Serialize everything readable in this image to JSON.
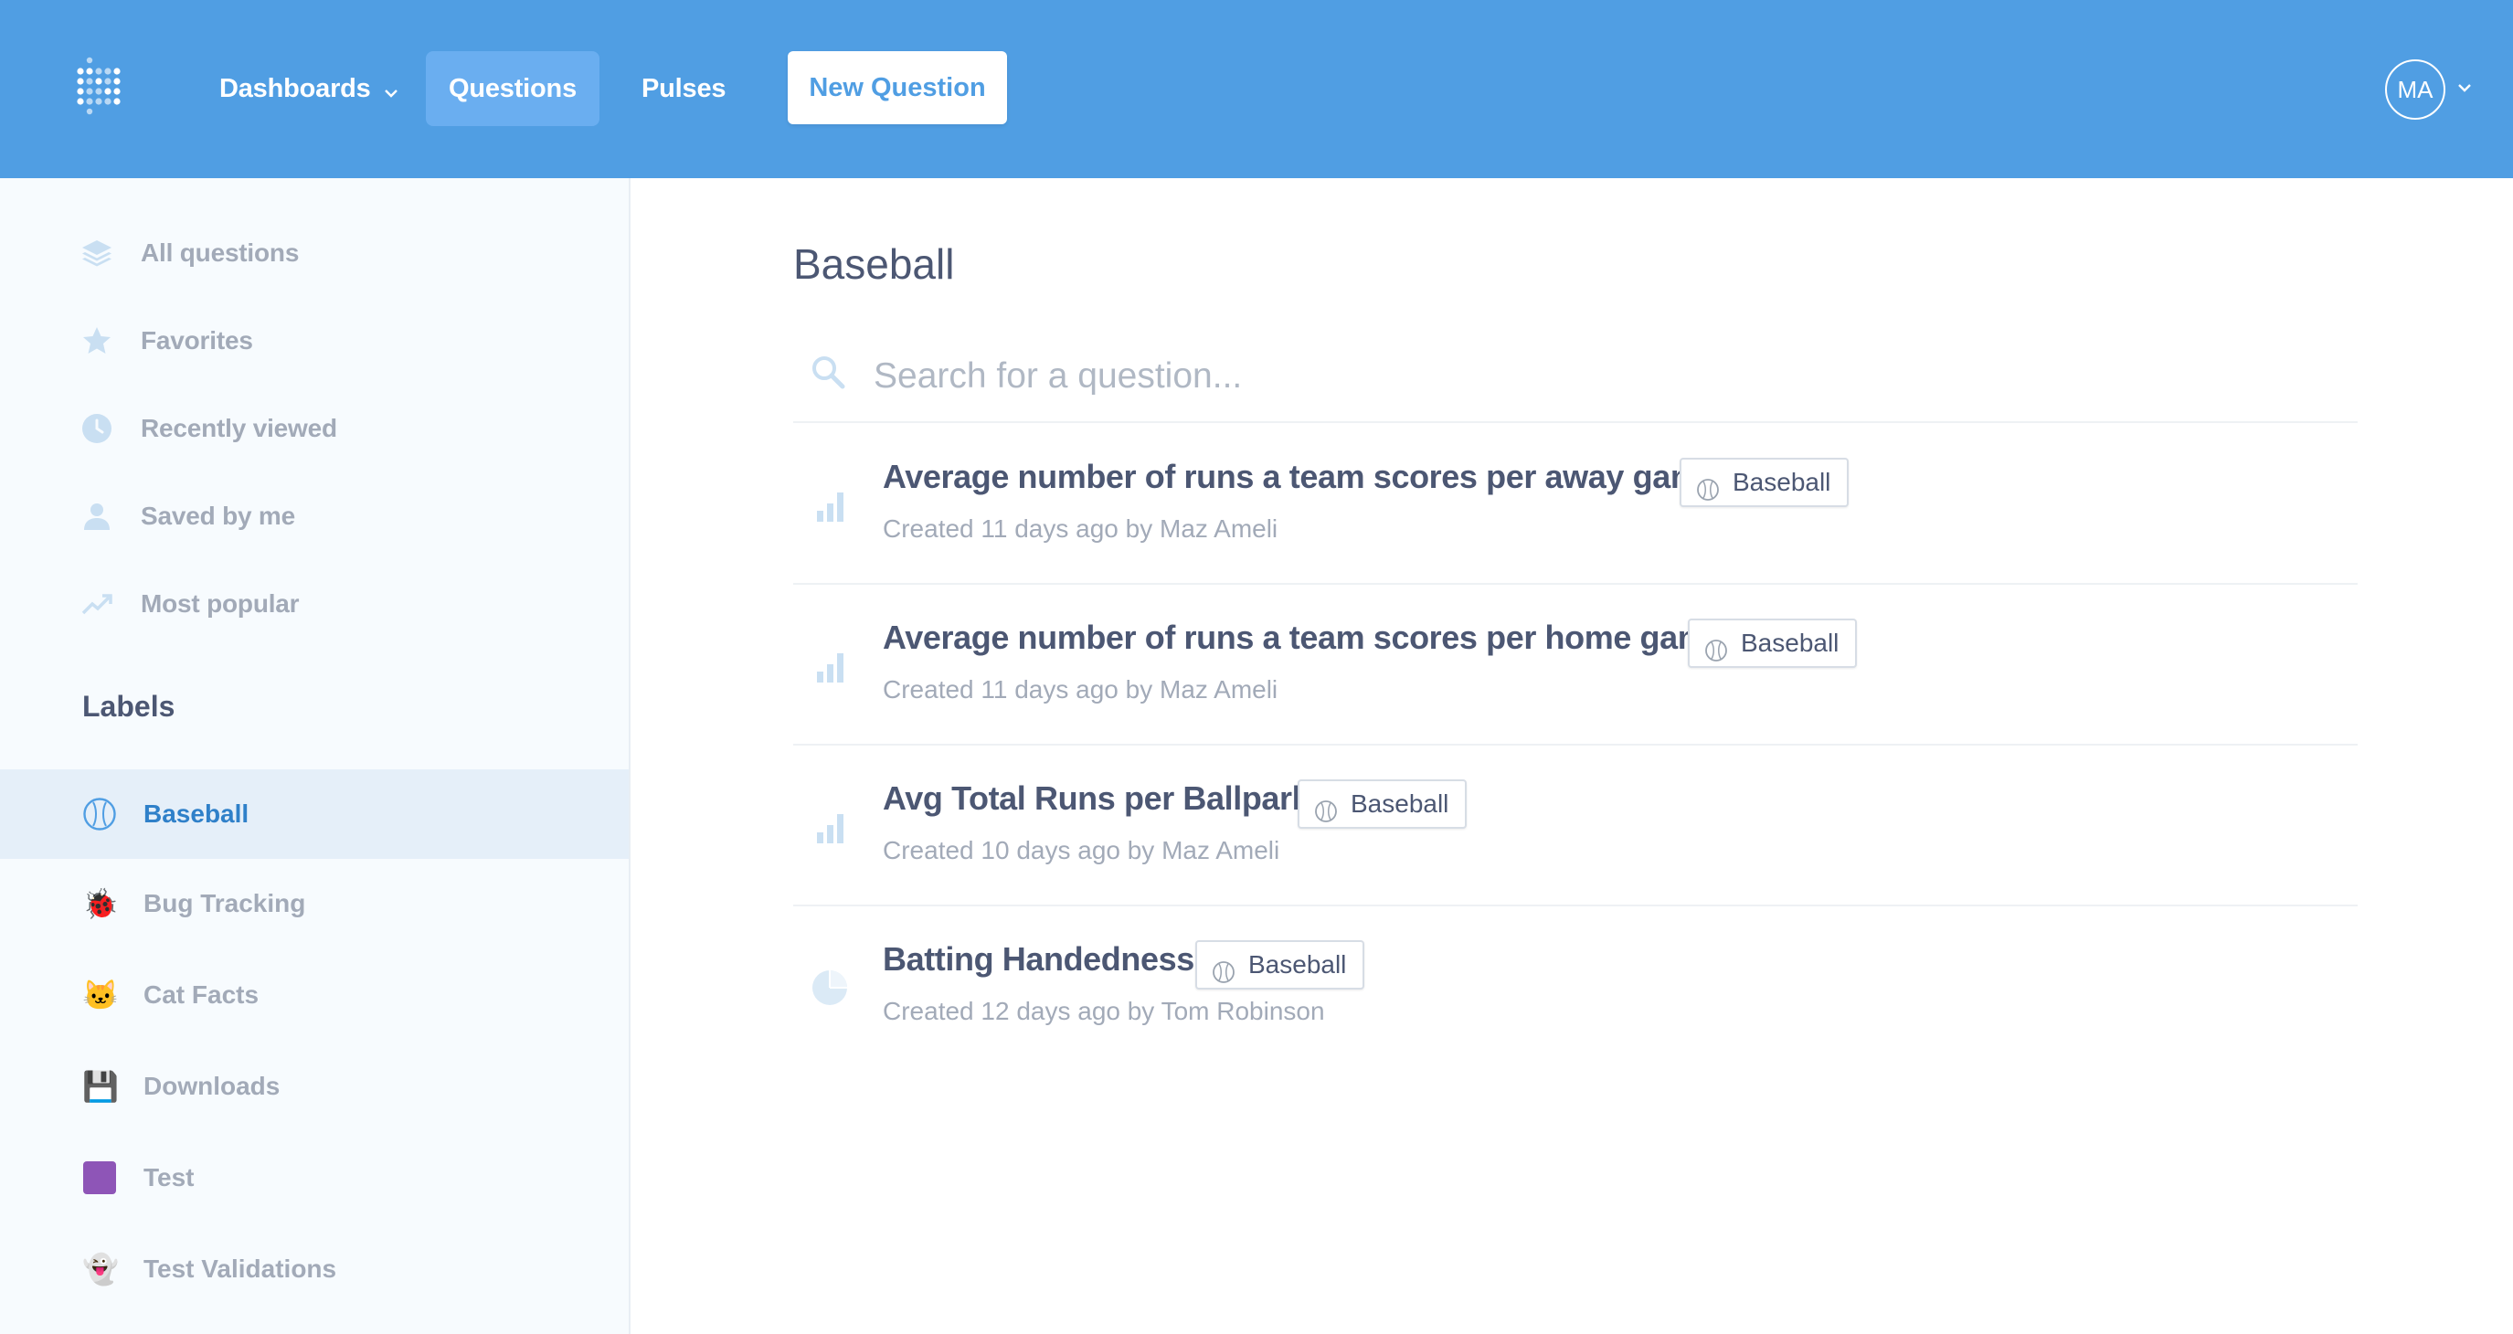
{
  "nav": {
    "items": [
      {
        "label": "Dashboards"
      },
      {
        "label": "Questions"
      },
      {
        "label": "Pulses"
      }
    ],
    "new_question_label": "New Question",
    "avatar_initials": "MA"
  },
  "sidebar": {
    "items": [
      {
        "label": "All questions",
        "icon": "stack-icon"
      },
      {
        "label": "Favorites",
        "icon": "star-icon"
      },
      {
        "label": "Recently viewed",
        "icon": "clock-icon"
      },
      {
        "label": "Saved by me",
        "icon": "person-icon"
      },
      {
        "label": "Most popular",
        "icon": "trend-icon"
      }
    ],
    "labels_heading": "Labels",
    "labels": [
      {
        "label": "Baseball",
        "icon": "baseball-icon",
        "active": true
      },
      {
        "label": "Bug Tracking",
        "icon": "ladybug-icon",
        "glyph": "🐞"
      },
      {
        "label": "Cat Facts",
        "icon": "cat-icon",
        "glyph": "🐱"
      },
      {
        "label": "Downloads",
        "icon": "floppy-disk-icon",
        "glyph": "💾"
      },
      {
        "label": "Test",
        "icon": "purple-square-icon",
        "color": "#8e55b7"
      },
      {
        "label": "Test Validations",
        "icon": "ghost-icon",
        "glyph": "👻"
      }
    ]
  },
  "main": {
    "title": "Baseball",
    "search_placeholder": "Search for a question...",
    "questions": [
      {
        "title": "Average number of runs a team scores per away game",
        "tag": "Baseball",
        "meta": "Created 11 days ago by Maz Ameli",
        "icon": "bar-chart-icon"
      },
      {
        "title": "Average number of runs a team scores per home game",
        "tag": "Baseball",
        "meta": "Created 11 days ago by Maz Ameli",
        "icon": "bar-chart-icon"
      },
      {
        "title": "Avg Total Runs per Ballpark",
        "tag": "Baseball",
        "meta": "Created 10 days ago by Maz Ameli",
        "icon": "bar-chart-icon"
      },
      {
        "title": "Batting Handedness",
        "tag": "Baseball",
        "meta": "Created 12 days ago by Tom Robinson",
        "icon": "pie-chart-icon"
      }
    ]
  },
  "colors": {
    "brand": "#509ee3",
    "nav_active": "#6aaef0",
    "sidebar_bg": "#f7fbfe",
    "sidebar_active_bg": "#e5eff9",
    "text_dark": "#4c5773",
    "text_muted": "#a2aab8"
  }
}
